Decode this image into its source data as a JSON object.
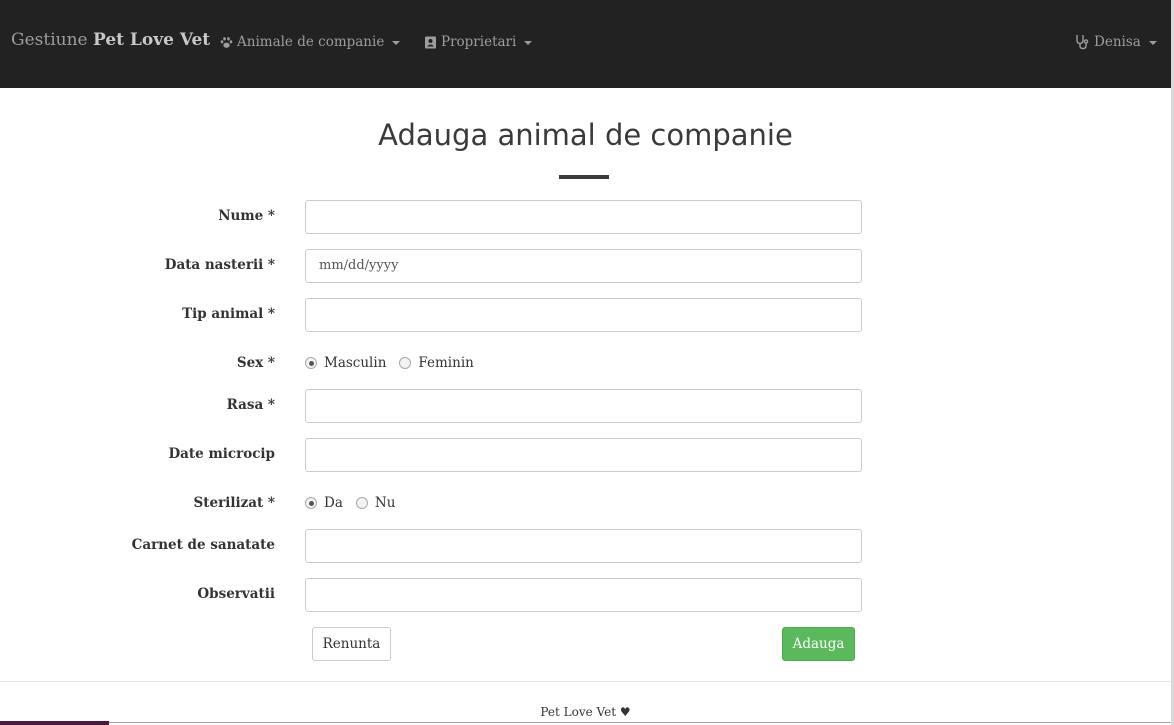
{
  "navbar": {
    "brand_prefix": "Gestiune",
    "brand_name": "Pet Love Vet",
    "menus": [
      {
        "label": "Animale de companie",
        "icon": "paw-icon"
      },
      {
        "label": "Proprietari",
        "icon": "contact-card-icon"
      }
    ],
    "user": {
      "label": "Denisa",
      "icon": "stethoscope-icon"
    }
  },
  "page": {
    "title": "Adauga animal de companie"
  },
  "form": {
    "name": {
      "label": "Nume *",
      "value": ""
    },
    "birth_date": {
      "label": "Data nasterii *",
      "placeholder": "mm/dd/yyyy"
    },
    "animal_type": {
      "label": "Tip animal *",
      "value": ""
    },
    "sex": {
      "label": "Sex *",
      "options": [
        "Masculin",
        "Feminin"
      ],
      "selected": "Masculin"
    },
    "breed": {
      "label": "Rasa *",
      "value": ""
    },
    "microchip": {
      "label": "Date microcip",
      "value": ""
    },
    "sterilized": {
      "label": "Sterilizat *",
      "options": [
        "Da",
        "Nu"
      ],
      "selected": "Da"
    },
    "health_book": {
      "label": "Carnet de sanatate",
      "value": ""
    },
    "notes": {
      "label": "Observatii",
      "value": ""
    }
  },
  "buttons": {
    "cancel": "Renunta",
    "submit": "Adauga"
  },
  "footer": {
    "text": "Pet Love Vet ♥"
  },
  "colors": {
    "navbar_bg": "#222222",
    "primary_success": "#5cb85c",
    "footer_accent": "#4a1942"
  }
}
